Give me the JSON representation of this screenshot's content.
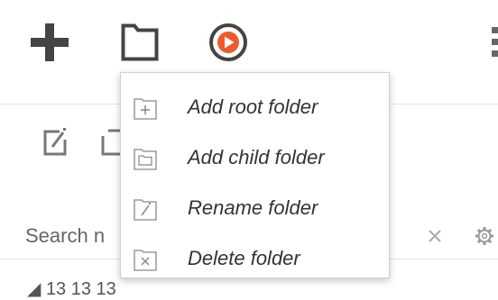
{
  "toolbar": {
    "buttons": [
      "plus-icon",
      "folder-icon",
      "play-icon",
      "more-vertical-icon"
    ],
    "accent_color": "#ee5b2b",
    "icon_color": "#444444"
  },
  "secondary_toolbar": {
    "buttons": [
      "edit-icon",
      "copy-icon"
    ]
  },
  "search": {
    "placeholder": "Search n",
    "clear_symbol": "×"
  },
  "tree": {
    "first_item_partial": "◢ 13 13 13"
  },
  "context_menu": {
    "items": [
      {
        "label": "Add root folder",
        "icon": "add-root-folder-icon"
      },
      {
        "label": "Add child folder",
        "icon": "add-child-folder-icon"
      },
      {
        "label": "Rename folder",
        "icon": "rename-folder-icon"
      },
      {
        "label": "Delete folder",
        "icon": "delete-folder-icon"
      }
    ]
  }
}
